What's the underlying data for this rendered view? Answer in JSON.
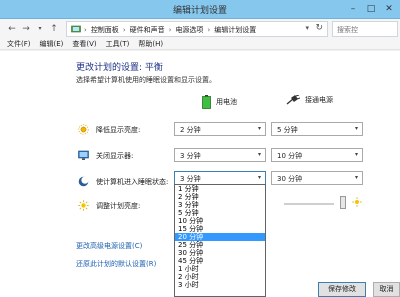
{
  "window": {
    "title": "编辑计划设置"
  },
  "address": {
    "crumbs": [
      "控制面板",
      "硬件和声音",
      "电源选项",
      "编辑计划设置"
    ],
    "search_placeholder": "搜索控"
  },
  "menu": [
    "文件(F)",
    "编辑(E)",
    "查看(V)",
    "工具(T)",
    "帮助(H)"
  ],
  "content": {
    "heading": "更改计划的设置: 平衡",
    "subheading": "选择希望计算机使用的睡眠设置和显示设置。",
    "columns": {
      "battery": "用电池",
      "plugged": "接通电源"
    },
    "rows": [
      {
        "label": "降低显示亮度:",
        "battery": "2 分钟",
        "plugged": "5 分钟"
      },
      {
        "label": "关闭显示器:",
        "battery": "3 分钟",
        "plugged": "10 分钟"
      },
      {
        "label": "使计算机进入睡眠状态:",
        "battery": "3 分钟",
        "plugged": "30 分钟"
      },
      {
        "label": "调整计划亮度:"
      }
    ],
    "links": {
      "advanced": "更改高级电源设置(C)",
      "restore": "还原此计划的默认设置(R)"
    }
  },
  "dropdown": {
    "options": [
      "1 分钟",
      "2 分钟",
      "3 分钟",
      "5 分钟",
      "10 分钟",
      "15 分钟",
      "20 分钟",
      "25 分钟",
      "30 分钟",
      "45 分钟",
      "1 小时",
      "2 小时",
      "3 小时"
    ],
    "highlighted": "20 分钟"
  },
  "buttons": {
    "save": "保存修改",
    "cancel": "取消"
  },
  "colors": {
    "titlebar": "#86c7ee",
    "link": "#1c5fb0",
    "heading": "#1e3287",
    "highlight": "#3399ff"
  }
}
